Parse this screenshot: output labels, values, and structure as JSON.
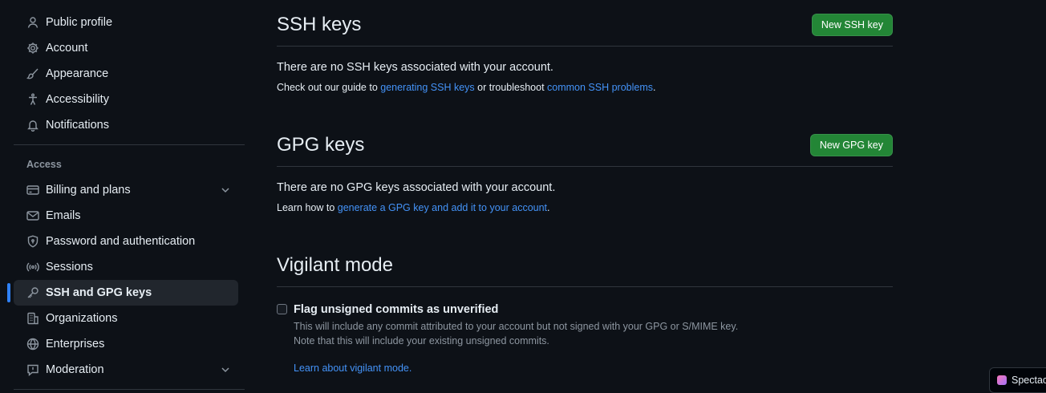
{
  "sidebar": {
    "items_top": [
      {
        "label": "Public profile",
        "icon": "person-icon"
      },
      {
        "label": "Account",
        "icon": "gear-icon"
      },
      {
        "label": "Appearance",
        "icon": "paintbrush-icon"
      },
      {
        "label": "Accessibility",
        "icon": "accessibility-icon"
      },
      {
        "label": "Notifications",
        "icon": "bell-icon"
      }
    ],
    "section_access": "Access",
    "items_access": [
      {
        "label": "Billing and plans",
        "icon": "credit-card-icon"
      },
      {
        "label": "Emails",
        "icon": "mail-icon"
      },
      {
        "label": "Password and authentication",
        "icon": "shield-lock-icon"
      },
      {
        "label": "Sessions",
        "icon": "broadcast-icon"
      },
      {
        "label": "SSH and GPG keys",
        "icon": "key-icon"
      },
      {
        "label": "Organizations",
        "icon": "organization-icon"
      },
      {
        "label": "Enterprises",
        "icon": "globe-icon"
      },
      {
        "label": "Moderation",
        "icon": "report-icon"
      }
    ]
  },
  "ssh": {
    "title": "SSH keys",
    "button": "New SSH key",
    "blank": "There are no SSH keys associated with your account.",
    "hint_pre": "Check out our guide to ",
    "hint_link1": "generating SSH keys",
    "hint_mid": " or troubleshoot ",
    "hint_link2": "common SSH problems",
    "hint_post": "."
  },
  "gpg": {
    "title": "GPG keys",
    "button": "New GPG key",
    "blank": "There are no GPG keys associated with your account.",
    "hint_pre": "Learn how to ",
    "hint_link": "generate a GPG key and add it to your account",
    "hint_post": "."
  },
  "vigilant": {
    "title": "Vigilant mode",
    "checkbox_label": "Flag unsigned commits as unverified",
    "checked": false,
    "note1": "This will include any commit attributed to your account but not signed with your GPG or S/MIME key.",
    "note2": "Note that this will include your existing unsigned commits.",
    "link": "Learn about vigilant mode."
  },
  "taskbar_chip": "Spectac",
  "colors": {
    "background": "#0d1117",
    "accent": "#2f81f7",
    "link": "#4493f8",
    "button_primary": "#238636"
  }
}
